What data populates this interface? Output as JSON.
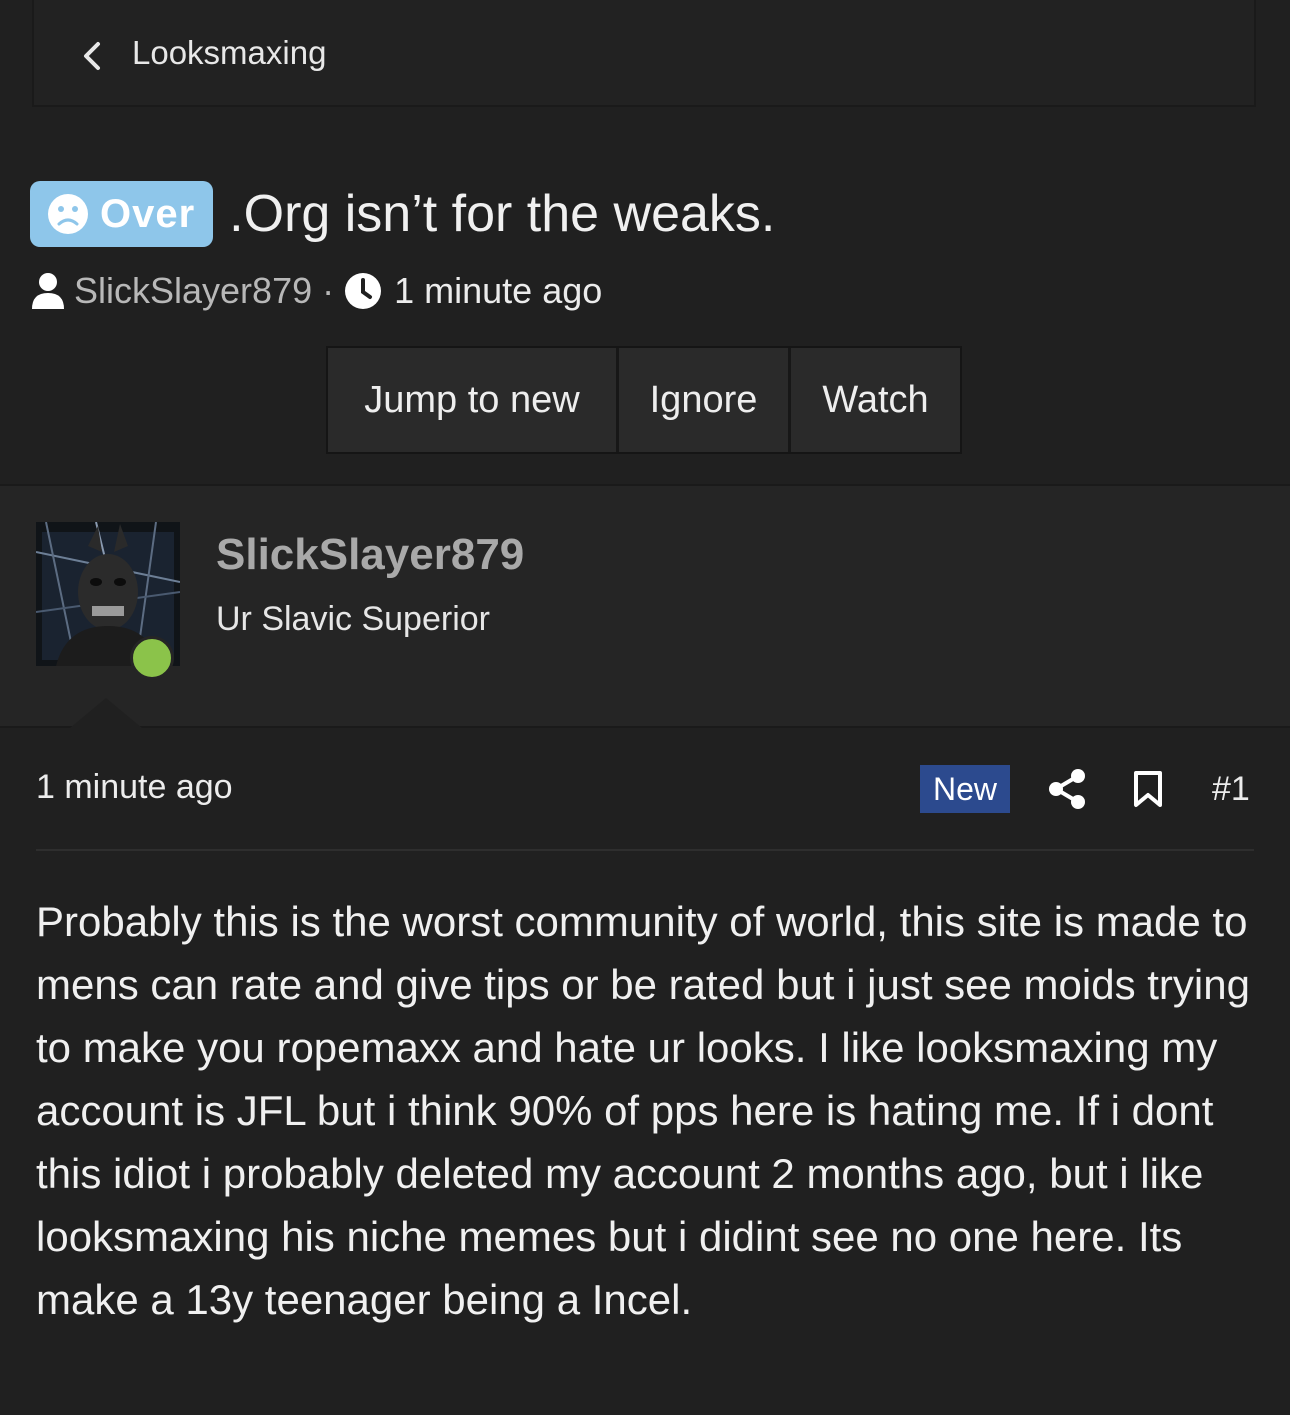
{
  "breadcrumb": {
    "label": "Looksmaxing",
    "icon": "chevron-left-icon"
  },
  "thread": {
    "prefix": {
      "label": "Over",
      "icon": "sad-face-icon",
      "color": "#8ec6ea"
    },
    "title": ".Org isn’t for the weaks.",
    "author": "SlickSlayer879",
    "separator": "·",
    "time": "1 minute ago"
  },
  "actions": {
    "jump_label": "Jump to new",
    "ignore_label": "Ignore",
    "watch_label": "Watch"
  },
  "post": {
    "author_name": "SlickSlayer879",
    "author_title": "Ur Slavic Superior",
    "online": true,
    "online_color": "#8bc34a",
    "time": "1 minute ago",
    "badge": "New",
    "badge_color": "#2c4a8e",
    "number": "#1",
    "body": "Probably this is the worst community of world, this site is made to mens can rate and give tips or be rated but i just see moids trying to make you ropemaxx and hate ur looks. I like looksmaxing my account is JFL but i think 90% of pps here is hating me. If i dont this idiot i probably deleted my account 2 months ago, but i like looksmaxing his niche memes but i didint see no one here. Its make a 13y teenager being a Incel."
  }
}
